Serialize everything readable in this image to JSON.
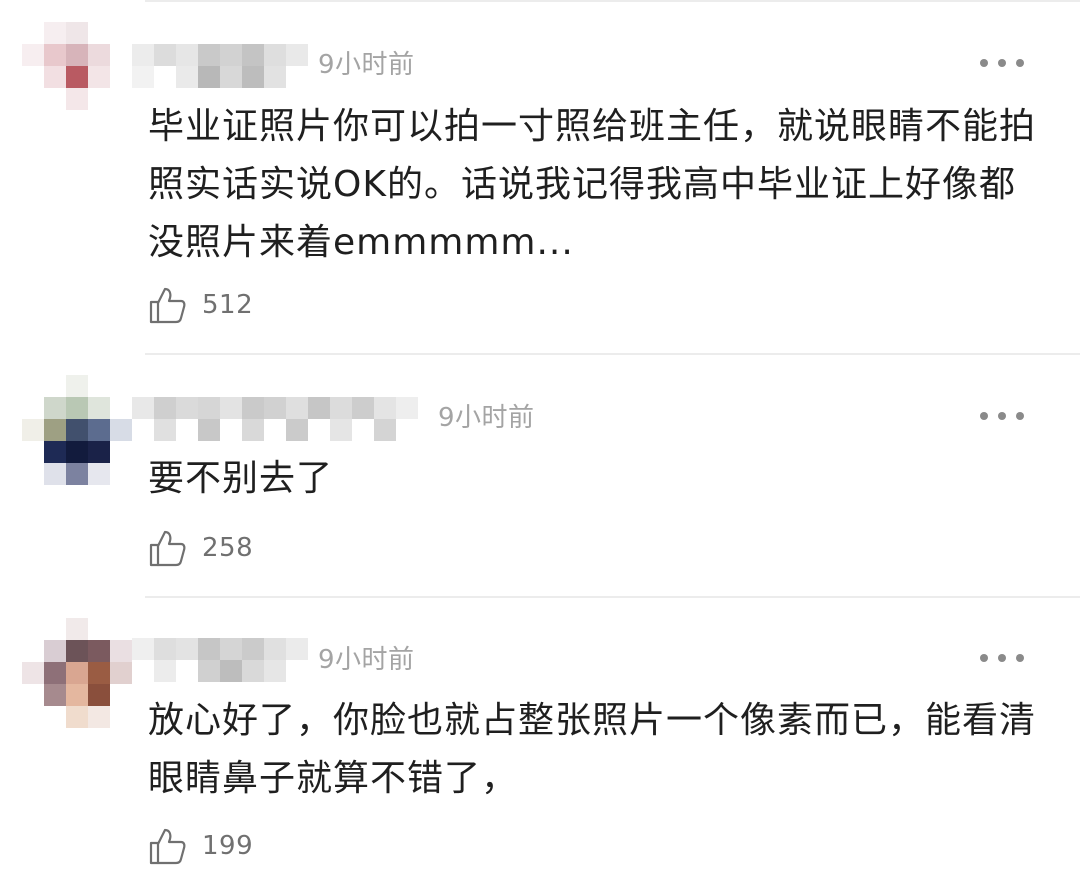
{
  "comments": [
    {
      "time": "9小时前",
      "text": "毕业证照片你可以拍一寸照给班主任，就说眼睛不能拍照实话实说OK的。话说我记得我高中毕业证上好像都没照片来着emmmmm...",
      "likes": "512"
    },
    {
      "time": "9小时前",
      "text": "要不别去了",
      "likes": "258"
    },
    {
      "time": "9小时前",
      "text": "放心好了，你脸也就占整张照片一个像素而已，能看清眼睛鼻子就算不错了，",
      "likes": "199"
    }
  ],
  "icons": {
    "like": "thumbs-up-icon",
    "more": "more-horizontal-icon"
  },
  "colors": {
    "text": "#1f1f1f",
    "meta": "#a4a4a4",
    "like_count": "#707070",
    "divider": "#ececec"
  }
}
